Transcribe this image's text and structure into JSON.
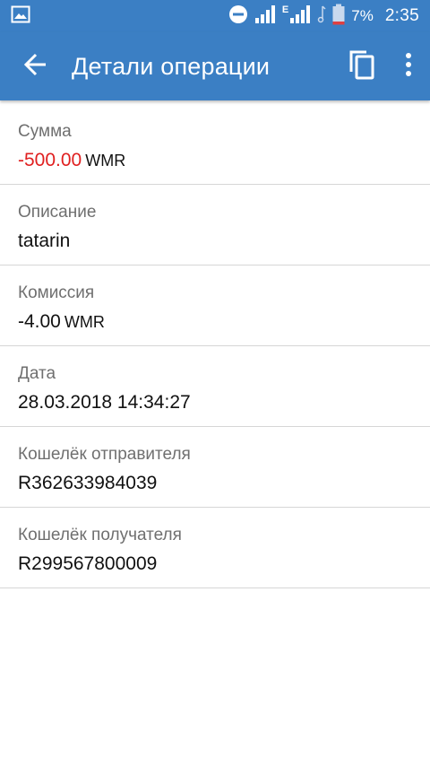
{
  "status_bar": {
    "icons": [
      "image-icon",
      "do-not-disturb-icon",
      "signal-icon",
      "network-e-icon",
      "signal-icon",
      "music-note-icon",
      "battery-icon"
    ],
    "network_type": "E",
    "battery": "7%",
    "time": "2:35"
  },
  "app_bar": {
    "title": "Детали операции",
    "back_icon": "arrow-back-icon",
    "copy_icon": "copy-icon",
    "more_icon": "more-vert-icon"
  },
  "details": {
    "amount": {
      "label": "Сумма",
      "value": "-500.00",
      "currency": "WMR"
    },
    "description": {
      "label": "Описание",
      "value": "tatarin"
    },
    "fee": {
      "label": "Комиссия",
      "value": "-4.00",
      "currency": "WMR"
    },
    "date": {
      "label": "Дата",
      "value": "28.03.2018 14:34:27"
    },
    "sender_wallet": {
      "label": "Кошелёк отправителя",
      "value": "R362633984039"
    },
    "recipient_wallet": {
      "label": "Кошелёк получателя",
      "value": "R299567800009"
    }
  },
  "colors": {
    "primary": "#3b7fc4",
    "negative_amount": "#e02020",
    "label": "#6f6f6f",
    "divider": "#d6d6d6"
  }
}
